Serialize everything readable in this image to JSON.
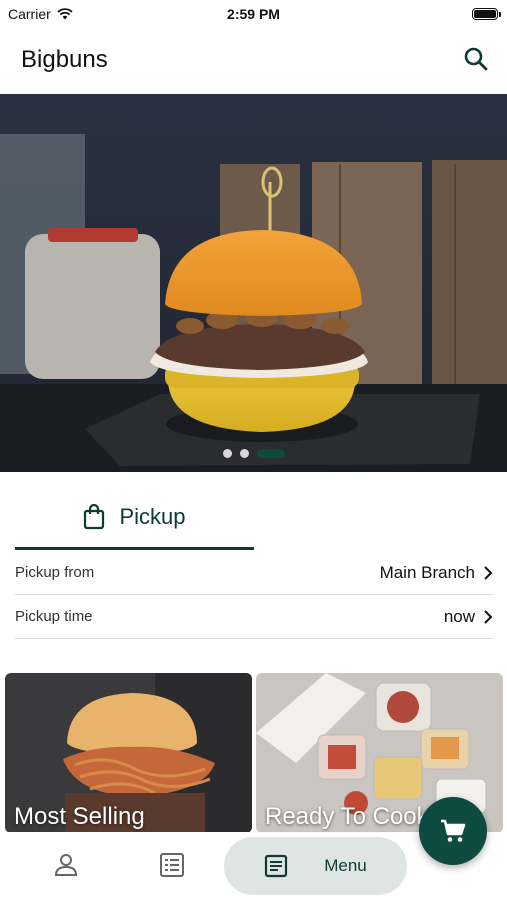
{
  "status_bar": {
    "carrier": "Carrier",
    "time": "2:59 PM"
  },
  "header": {
    "title": "Bigbuns",
    "search_icon": "search-icon"
  },
  "hero": {
    "slides": 3,
    "active_slide": 3
  },
  "order_mode": {
    "label": "Pickup",
    "icon": "shopping-bag-icon"
  },
  "pickup": {
    "from_label": "Pickup from",
    "from_value": "Main Branch",
    "time_label": "Pickup time",
    "time_value": "now"
  },
  "categories": [
    {
      "name": "Most Selling"
    },
    {
      "name": "Ready To Cook"
    }
  ],
  "bottom_nav": {
    "menu_label": "Menu"
  },
  "colors": {
    "primary": "#0d4a40",
    "menu_pill": "#dfe5e3"
  }
}
